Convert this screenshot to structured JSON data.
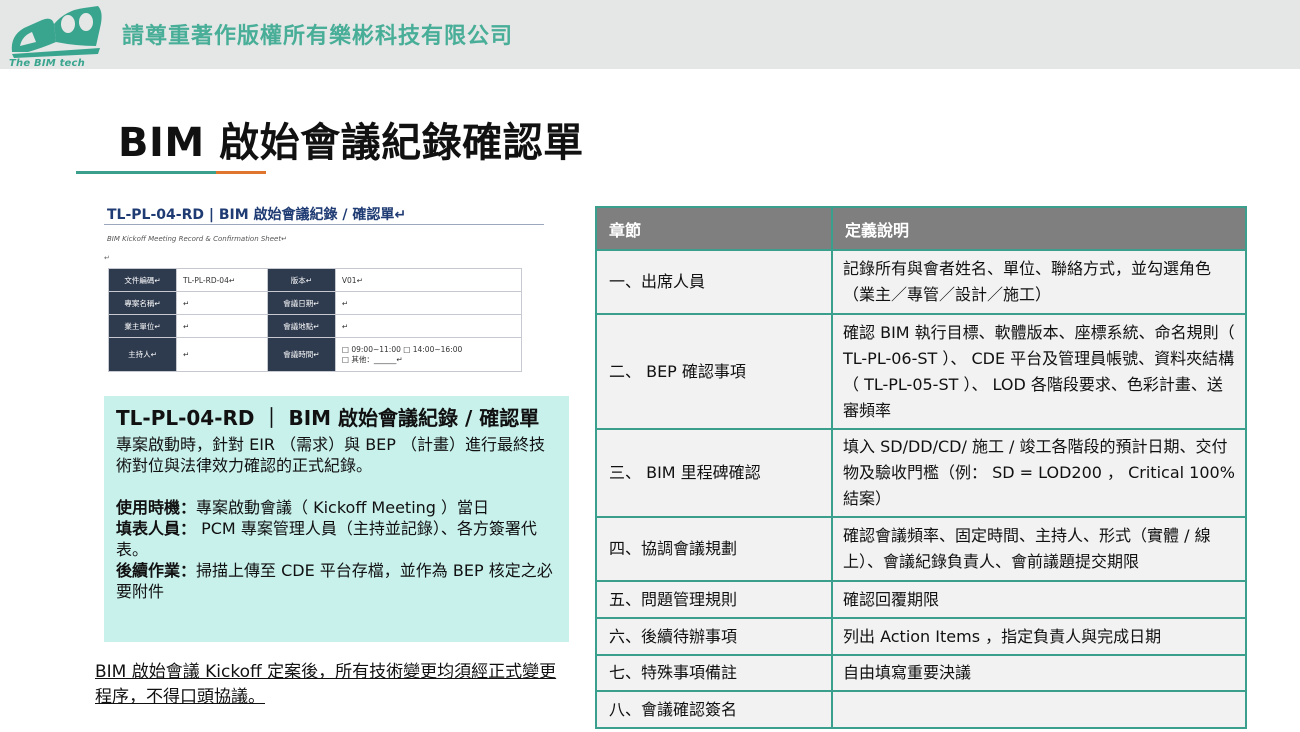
{
  "header": {
    "logo_text": "The BIM tech",
    "company": "請尊重著作版權所有樂彬科技有限公司"
  },
  "title": "BIM 啟始會議紀錄確認單",
  "doc_preview": {
    "title": "TL-PL-04-RD | BIM 啟始會議紀錄 / 確認單↵",
    "subtitle": "BIM Kickoff Meeting Record & Confirmation Sheet↵",
    "mark": "↵",
    "rows": [
      {
        "k1": "文件編碼↵",
        "v1": "TL-PL-RD-04↵",
        "k2": "版本↵",
        "v2": "V01↵"
      },
      {
        "k1": "專案名稱↵",
        "v1": "↵",
        "k2": "會議日期↵",
        "v2": "↵"
      },
      {
        "k1": "業主單位↵",
        "v1": "↵",
        "k2": "會議地點↵",
        "v2": "↵"
      },
      {
        "k1": "主持人↵",
        "v1": "↵",
        "k2": "會議時間↵",
        "v2": "□ 09:00~11:00  □ 14:00~16:00",
        "v2b": "□ 其他：______↵"
      }
    ]
  },
  "info_box": {
    "title": "TL-PL-04-RD ｜ BIM 啟始會議紀錄 / 確認單",
    "desc": "專案啟動時，針對 EIR （需求）與 BEP （計畫）進行最終技術對位與法律效力確認的正式紀錄。",
    "timing_label": "使用時機：",
    "timing_value": "專案啟動會議（ Kickoff Meeting ）當日",
    "filler_label": "填表人員：",
    "filler_value": " PCM 專案管理人員（主持並記錄）、各方簽署代表。",
    "follow_label": "後續作業：",
    "follow_value": "掃描上傳至 CDE 平台存檔，並作為 BEP 核定之必要附件"
  },
  "footer_note": "BIM 啟始會議 Kickoff 定案後，所有技術變更均須經正式變更程序，不得口頭協議。",
  "table": {
    "headers": [
      "章節",
      "定義說明"
    ],
    "rows": [
      [
        "一、出席人員",
        "記錄所有與會者姓名、單位、聯絡方式，並勾選角色（業主／專管／設計／施工）"
      ],
      [
        "二、 BEP 確認事項",
        "確認 BIM 執行目標、軟體版本、座標系統、命名規則（ TL-PL-06-ST ）、 CDE 平台及管理員帳號、資料夾結構（ TL-PL-05-ST ）、 LOD 各階段要求、色彩計畫、送審頻率"
      ],
      [
        "三、 BIM 里程碑確認",
        "填入 SD/DD/CD/ 施工 / 竣工各階段的預計日期、交付物及驗收門檻（例： SD = LOD200 ， Critical 100% 結案）"
      ],
      [
        "四、協調會議規劃",
        "確認會議頻率、固定時間、主持人、形式（實體 / 線上）、會議紀錄負責人、會前議題提交期限"
      ],
      [
        "五、問題管理規則",
        "確認回覆期限"
      ],
      [
        "六、後續待辦事項",
        "列出 Action Items ，指定負責人與完成日期"
      ],
      [
        "七、特殊事項備註",
        "自由填寫重要決議"
      ],
      [
        "八、會議確認簽名",
        ""
      ]
    ]
  }
}
